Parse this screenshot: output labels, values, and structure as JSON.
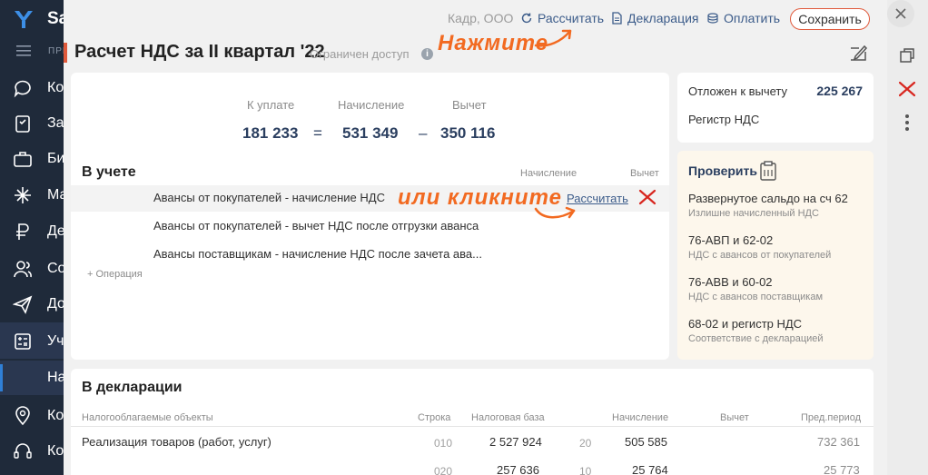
{
  "sidebar": {
    "brand": "Sa",
    "section_label": "ПРЕ",
    "items": [
      {
        "label": "Ко",
        "icon": "chat-icon"
      },
      {
        "label": "За",
        "icon": "tasks-icon"
      },
      {
        "label": "Би",
        "icon": "briefcase-icon"
      },
      {
        "label": "Ма",
        "icon": "marketing-icon"
      },
      {
        "label": "Де",
        "icon": "money-icon"
      },
      {
        "label": "Со",
        "icon": "staff-icon"
      },
      {
        "label": "До",
        "icon": "send-icon"
      },
      {
        "label": "Уч",
        "icon": "calculator-icon"
      },
      {
        "label": "Ко",
        "icon": "pin-icon"
      },
      {
        "label": "Ко",
        "icon": "support-icon"
      }
    ],
    "sub_item": "На"
  },
  "toolbar": {
    "org": "Кадр, ООО",
    "calculate": "Рассчитать",
    "declaration": "Декларация",
    "pay": "Оплатить",
    "save": "Сохранить"
  },
  "header": {
    "title": "Расчет НДС за II квартал '22",
    "access": "Ограничен доступ",
    "info_glyph": "i"
  },
  "hints": {
    "press": "Нажмите",
    "or_click": "или кликните"
  },
  "summary": {
    "to_pay_label": "К уплате",
    "to_pay": "181 233",
    "accrual_label": "Начисление",
    "accrual": "531 349",
    "deduction_label": "Вычет",
    "deduction": "350 116",
    "eq": "=",
    "minus": "–"
  },
  "accounting": {
    "title": "В учете",
    "col_accrual": "Начисление",
    "col_deduction": "Вычет",
    "rows": [
      {
        "label": "Авансы от покупателей - начисление НДС",
        "action": "Рассчитать"
      },
      {
        "label": "Авансы от покупателей - вычет НДС после отгрузки аванса"
      },
      {
        "label": "Авансы поставщикам - начисление НДС после зачета ава..."
      }
    ],
    "add_operation": "+ Операция"
  },
  "deferred": {
    "label": "Отложен к вычету",
    "value": "225 267",
    "register": "Регистр НДС"
  },
  "check": {
    "title": "Проверить",
    "items": [
      {
        "title": "Развернутое сальдо на сч 62",
        "sub": "Излишне начисленный НДС"
      },
      {
        "title": "76-АВП и 62-02",
        "sub": "НДС с авансов от покупателей"
      },
      {
        "title": "76-АВВ и 60-02",
        "sub": "НДС с авансов поставщикам"
      },
      {
        "title": "68-02 и регистр НДС",
        "sub": "Соответствие с декларацией"
      }
    ]
  },
  "declaration": {
    "title": "В декларации",
    "headers": {
      "objects": "Налогооблагаемые объекты",
      "line": "Строка",
      "base": "Налоговая база",
      "accrual": "Начисление",
      "deduction": "Вычет",
      "prev": "Пред.период"
    },
    "rows": [
      {
        "name": "Реализация товаров (работ, услуг)",
        "line": "010",
        "base": "2 527 924",
        "rate": "20",
        "accrual": "505 585",
        "prev": "732 361"
      },
      {
        "name": "",
        "line": "020",
        "base": "257 636",
        "rate": "10",
        "accrual": "25 764",
        "prev": "25 773"
      }
    ]
  },
  "colors": {
    "sidebar_bg": "#1f2a3a",
    "accent": "#e05a3c",
    "hint": "#f26a21",
    "link": "#3c5c8a"
  }
}
